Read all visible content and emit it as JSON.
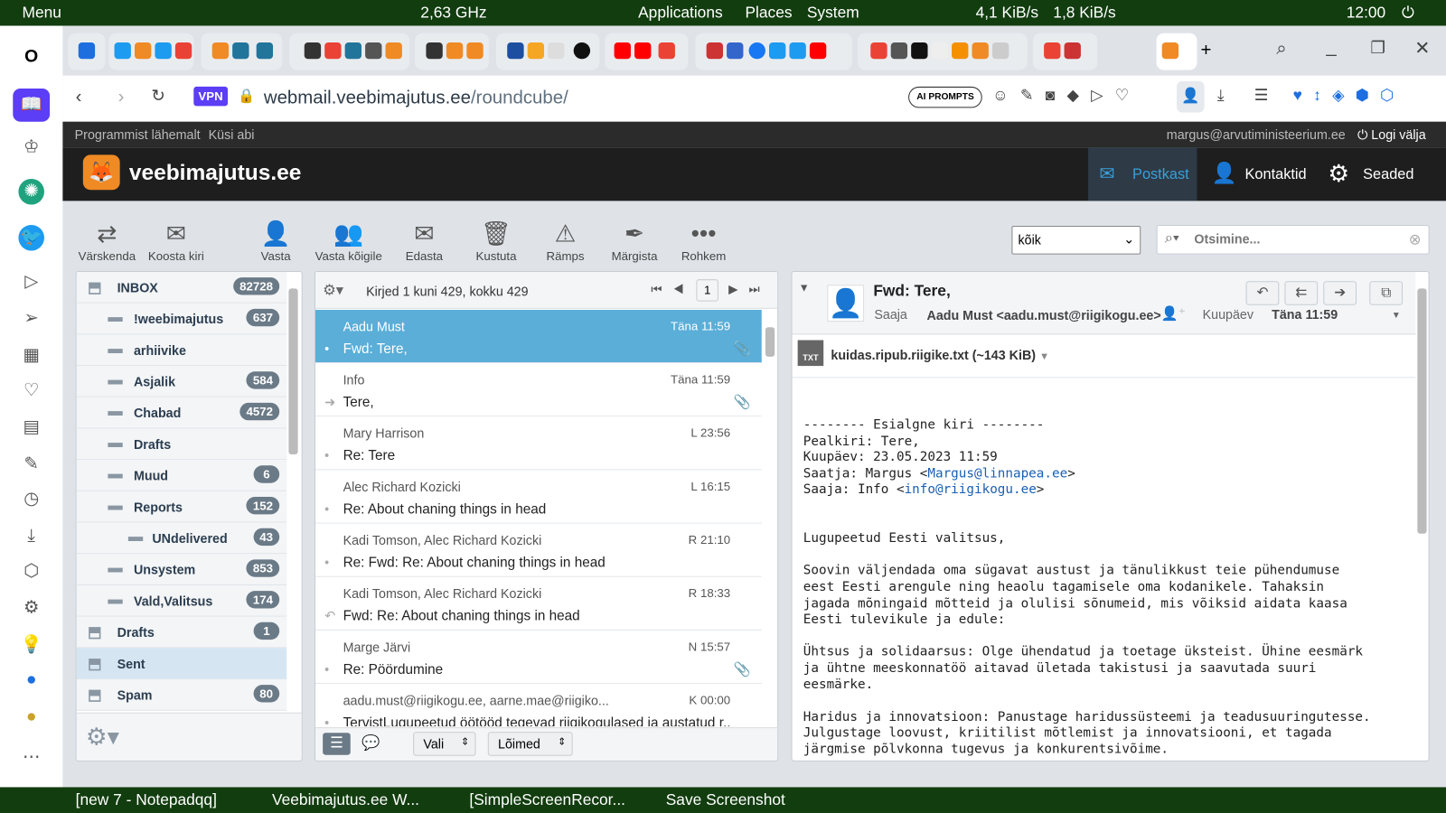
{
  "system_bar": {
    "menu": "Menu",
    "cpu": "2,63 GHz",
    "applications": "Applications",
    "places": "Places",
    "system": "System",
    "net_down": "4,1 KiB/s",
    "net_up": "1,8 KiB/s",
    "clock": "12:00"
  },
  "browser": {
    "vpn": "VPN",
    "url_host": "webmail.veebimajutus.ee",
    "url_path": "/roundcube/",
    "ai_prompts": "AI PROMPTS"
  },
  "roundcube": {
    "top_links": [
      "Programmist lähemalt",
      "Küsi abi"
    ],
    "user": "margus@arvutiministeerium.ee",
    "logout": "Logi välja",
    "logo": "veebimajutus.ee",
    "nav": [
      "Postkast",
      "Kontaktid",
      "Seaded"
    ],
    "toolbar": [
      "Värskenda",
      "Koosta kiri",
      "Vasta",
      "Vasta kõigile",
      "Edasta",
      "Kustuta",
      "Rämps",
      "Märgista",
      "Rohkem"
    ],
    "filter": "kõik",
    "search_placeholder": "Otsimine...",
    "folders": [
      {
        "name": "INBOX",
        "count": "82728"
      },
      {
        "name": "!weebimajutus",
        "count": "637"
      },
      {
        "name": "arhiivike",
        "count": ""
      },
      {
        "name": "Asjalik",
        "count": "584"
      },
      {
        "name": "Chabad",
        "count": "4572"
      },
      {
        "name": "Drafts",
        "count": ""
      },
      {
        "name": "Muud",
        "count": "6"
      },
      {
        "name": "Reports",
        "count": "152"
      },
      {
        "name": "UNdelivered",
        "count": "43"
      },
      {
        "name": "Unsystem",
        "count": "853"
      },
      {
        "name": "Vald,Valitsus",
        "count": "174"
      },
      {
        "name": "Drafts",
        "count": "1"
      },
      {
        "name": "Sent",
        "count": ""
      },
      {
        "name": "Spam",
        "count": "80"
      }
    ],
    "list_header": "Kirjed 1 kuni 429, kokku 429",
    "page": "1",
    "messages": [
      {
        "from": "Aadu Must",
        "date": "Täna 11:59",
        "subject": "Fwd: Tere,"
      },
      {
        "from": "Info",
        "date": "Täna 11:59",
        "subject": "Tere,"
      },
      {
        "from": "Mary Harrison",
        "date": "L 23:56",
        "subject": "Re: Tere"
      },
      {
        "from": "Alec Richard Kozicki",
        "date": "L 16:15",
        "subject": "Re: About chaning things in head"
      },
      {
        "from": "Kadi Tomson, Alec Richard Kozicki",
        "date": "R 21:10",
        "subject": "Re: Fwd: Re: About chaning things in head"
      },
      {
        "from": "Kadi Tomson, Alec Richard Kozicki",
        "date": "R 18:33",
        "subject": "Fwd: Re: About chaning things in head"
      },
      {
        "from": "Marge Järvi",
        "date": "N 15:57",
        "subject": "Re: Pöördumine"
      },
      {
        "from": "aadu.must@riigikogu.ee, aarne.mae@riigiko...",
        "date": "K 00:00",
        "subject": "TervistLugupeetud öötööd tegevad riigikogulased ja austatud r..."
      }
    ],
    "list_footer": {
      "select": "Vali",
      "threads": "Lõimed"
    },
    "preview": {
      "subject": "Fwd: Tere,",
      "to_label": "Saaja",
      "to": "Aadu Must <aadu.must@riigikogu.ee>",
      "date_label": "Kuupäev",
      "date": "Täna 11:59",
      "attachment": "kuidas.ripub.riigike.txt (~143 KiB)",
      "attachment_type": "TXT",
      "body_lines": [
        "-------- Esialgne kiri --------",
        "Pealkiri: Tere,",
        "Kuupäev: 23.05.2023 11:59"
      ],
      "from_line_prefix": "Saatja: Margus <",
      "from_email": "Margus@linnapea.ee",
      "to_line_prefix": "Saaja: Info <",
      "to_email": "info@riigikogu.ee",
      "paragraphs": [
        "Lugupeetud Eesti valitsus,",
        "Soovin väljendada oma sügavat austust ja tänulikkust teie pühendumuse\neest Eesti arengule ning heaolu tagamisele oma kodanikele. Tahaksin\njagada mõningaid mõtteid ja olulisi sõnumeid, mis võiksid aidata kaasa\nEesti tulevikule ja edule:",
        "Ühtsus ja solidaarsus: Olge ühendatud ja toetage üksteist. Ühine eesmärk\nja ühtne meeskonnatöö aitavad ületada takistusi ja saavutada suuri\neesmärke.",
        "Haridus ja innovatsioon: Panustage haridussüsteemi ja teadusuuringutesse.\nJulgustage loovust, kriitilist mõtlemist ja innovatsiooni, et tagada\njärgmise põlvkonna tugevus ja konkurentsivõime."
      ]
    }
  },
  "taskbar": [
    "[new 7 - Notepadqq]",
    "Veebimajutus.ee W...",
    "[SimpleScreenRecor...",
    "Save Screenshot"
  ]
}
